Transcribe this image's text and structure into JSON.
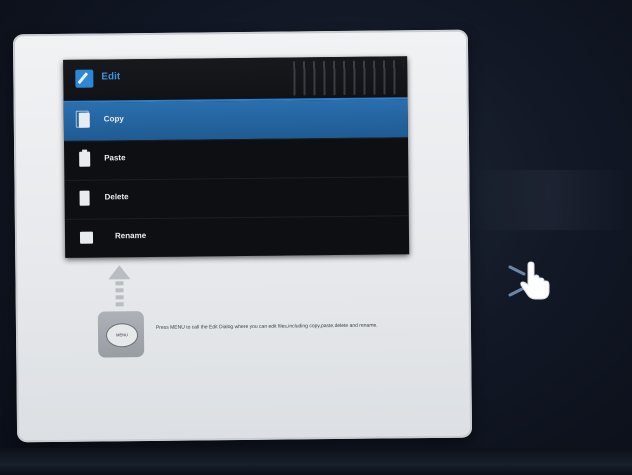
{
  "edit_menu": {
    "title": "Edit",
    "items": [
      {
        "label": "Copy",
        "icon": "copy-icon",
        "selected": true
      },
      {
        "label": "Paste",
        "icon": "paste-icon",
        "selected": false
      },
      {
        "label": "Delete",
        "icon": "delete-icon",
        "selected": false
      },
      {
        "label": "Rename",
        "icon": "rename-icon",
        "selected": false
      }
    ]
  },
  "help": {
    "menu_key_label": "MENU",
    "text": "Press MENU to call the Edit Dialog where you can edit files,including copy,paste,delete and rename."
  },
  "colors": {
    "accent": "#2f7fc8",
    "selected_bg": "#2a6fae",
    "menu_bg": "#0d0f12",
    "panel_bg": "#eceef1"
  }
}
